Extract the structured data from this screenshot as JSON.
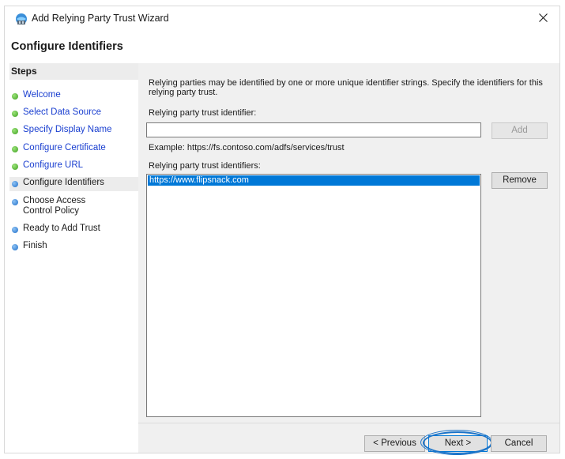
{
  "window": {
    "title": "Add Relying Party Trust Wizard",
    "page_title": "Configure Identifiers"
  },
  "steps": {
    "header": "Steps",
    "items": [
      {
        "label": "Welcome",
        "status": "done"
      },
      {
        "label": "Select Data Source",
        "status": "done"
      },
      {
        "label": "Specify Display Name",
        "status": "done"
      },
      {
        "label": "Configure Certificate",
        "status": "done"
      },
      {
        "label": "Configure URL",
        "status": "done"
      },
      {
        "label": "Configure Identifiers",
        "status": "current"
      },
      {
        "label": "Choose Access Control Policy",
        "status": "pending"
      },
      {
        "label": "Ready to Add Trust",
        "status": "pending"
      },
      {
        "label": "Finish",
        "status": "pending"
      }
    ]
  },
  "main": {
    "intro": "Relying parties may be identified by one or more unique identifier strings. Specify the identifiers for this relying party trust.",
    "identifier_label": "Relying party trust identifier:",
    "identifier_value": "",
    "add_button": "Add",
    "example": "Example: https://fs.contoso.com/adfs/services/trust",
    "identifiers_label": "Relying party trust identifiers:",
    "identifiers": [
      "https://www.flipsnack.com"
    ],
    "remove_button": "Remove"
  },
  "footer": {
    "previous_button": "< Previous",
    "next_button": "Next >",
    "cancel_button": "Cancel"
  },
  "colors": {
    "link_blue": "#1a3fd0",
    "selection": "#0078d7",
    "step_done": "#3ea020",
    "step_pending": "#1e6ec8",
    "highlight": "#1a73c8"
  }
}
